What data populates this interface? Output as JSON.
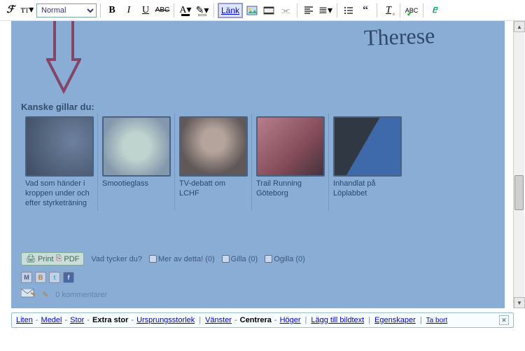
{
  "toolbar": {
    "format_value": "Normal",
    "link_label": "Länk"
  },
  "content": {
    "signature": "Therese",
    "recommend_title": "Kanske gillar du:",
    "cards": [
      {
        "caption": "Vad som händer i kroppen under och efter styrketräning"
      },
      {
        "caption": "Smootieglass"
      },
      {
        "caption": "TV-debatt om LCHF"
      },
      {
        "caption": "Trail Running Göteborg"
      },
      {
        "caption": "Inhandlat på Löplabbet"
      }
    ],
    "print_label": "Print",
    "pdf_label": "PDF",
    "feedback_label": "Vad tycker du?",
    "feedback_options": {
      "more": "Mer av detta! (0)",
      "like": "Gilla (0)",
      "dislike": "Ogilla (0)"
    },
    "comments": "0 kommentarer"
  },
  "selbar": {
    "size": {
      "small": "Liten",
      "medium": "Medel",
      "large": "Stor",
      "xlarge": "Extra stor",
      "orig": "Ursprungsstorlek"
    },
    "align": {
      "left": "Vänster",
      "center": "Centrera",
      "right": "Höger"
    },
    "caption": "Lägg till bildtext",
    "props": "Egenskaper",
    "remove": "Ta bort"
  }
}
